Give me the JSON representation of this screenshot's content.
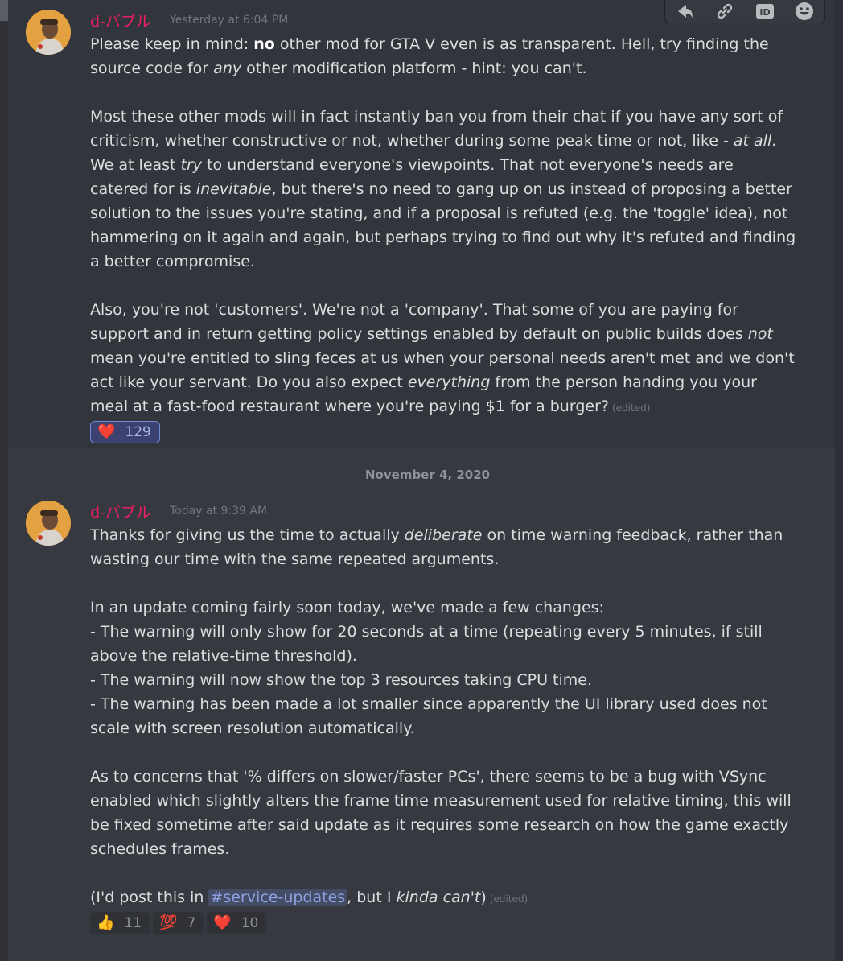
{
  "toolbar": {
    "icons": [
      "reply-icon",
      "link-icon",
      "id-icon",
      "emoji-icon"
    ]
  },
  "messages": [
    {
      "username": "d-バブル",
      "timestamp": "Yesterday at 6:04 PM",
      "edited": "(edited)",
      "lines": {
        "l1a": "Please keep in mind: ",
        "l1b": "no",
        "l1c": " other mod for GTA V even is as transparent. Hell, try finding the",
        "l2a": "source code for ",
        "l2b": "any",
        "l2c": " other modification platform - hint: you can't.",
        "l3a": "Most these other mods will in fact instantly ban you from their chat if you have any sort of",
        "l4a": "criticism, whether constructive or not, whether during some peak time or not, like - ",
        "l4b": "at all",
        "l4c": ".",
        "l5a": "We at least ",
        "l5b": "try",
        "l5c": " to understand everyone's viewpoints. That not everyone's needs are",
        "l6a": "catered for is ",
        "l6b": "inevitable",
        "l6c": ", but there's no need to gang up on us instead of proposing a better",
        "l7a": "solution to the issues you're stating, and if a proposal is refuted (e.g. the 'toggle' idea), not",
        "l8a": "hammering on it again and again, but perhaps trying to find out why it's refuted and finding",
        "l9a": "a better compromise.",
        "l10a": "Also, you're not 'customers'. We're not a 'company'. That some of you are paying for",
        "l11a": "support and in return getting policy settings enabled by default on public builds does ",
        "l11b": "not",
        "l12a": "mean you're entitled to sling feces at us when your personal needs aren't met and we don't",
        "l13a": "act like your servant. Do you also expect ",
        "l13b": "everything",
        "l13c": " from the person handing you your",
        "l14a": "meal at a fast-food restaurant where you're paying $1 for a burger?"
      },
      "reactions": [
        {
          "emoji": "❤️",
          "count": "129"
        }
      ]
    },
    {
      "username": "d-バブル",
      "timestamp": "Today at 9:39 AM",
      "edited": "(edited)",
      "lines": {
        "l1a": "Thanks for giving us the time to actually ",
        "l1b": "deliberate",
        "l1c": " on time warning feedback, rather than",
        "l2a": "wasting our time with the same repeated arguments.",
        "l3a": "In an update coming fairly soon today, we've made a few changes:",
        "l4a": "- The warning will only show for 20 seconds at a time (repeating every 5 minutes, if still",
        "l5a": "above the relative-time threshold).",
        "l6a": "- The warning will now show the top 3 resources taking CPU time.",
        "l7a": "- The warning has been made a lot smaller since apparently the UI library used does not",
        "l8a": "scale with screen resolution automatically.",
        "l9a": "As to concerns that '% differs on slower/faster PCs', there seems to be a bug with VSync",
        "l10a": "enabled which slightly alters the frame time measurement used for relative timing, this will",
        "l11a": "be fixed sometime after said update as it requires some research on how the game exactly",
        "l12a": "schedules frames.",
        "l13a": "(I'd post this in ",
        "l13b": "#service-updates",
        "l13c": ", but I ",
        "l13d": "kinda can't",
        "l13e": ")"
      },
      "reactions": [
        {
          "emoji": "👍",
          "count": "11"
        },
        {
          "emoji": "💯",
          "count": "7"
        },
        {
          "emoji": "❤️",
          "count": "10"
        }
      ]
    }
  ],
  "date_divider": "November 4, 2020",
  "colors": {
    "username": "#e91e63",
    "background": "#36393f",
    "text": "#dcddde",
    "mention": "#8ea1e1"
  }
}
